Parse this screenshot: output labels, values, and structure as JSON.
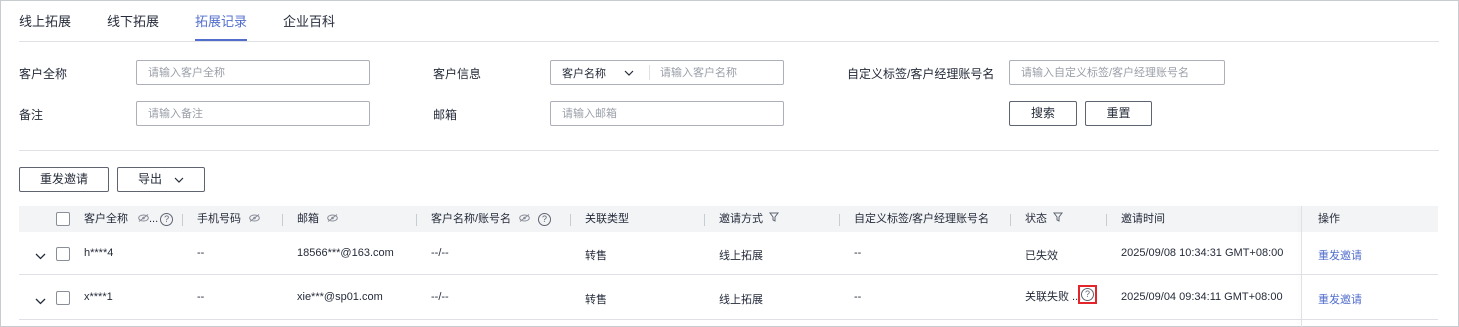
{
  "tabs": [
    "线上拓展",
    "线下拓展",
    "拓展记录",
    "企业百科"
  ],
  "active_tab": 2,
  "filters": {
    "customer_full_name": {
      "label": "客户全称",
      "placeholder": "请输入客户全称"
    },
    "customer_info": {
      "label": "客户信息",
      "select_value": "客户名称",
      "placeholder": "请输入客户名称"
    },
    "custom_tag": {
      "label": "自定义标签/客户经理账号名",
      "placeholder": "请输入自定义标签/客户经理账号名"
    },
    "remark": {
      "label": "备注",
      "placeholder": "请输入备注"
    },
    "email": {
      "label": "邮箱",
      "placeholder": "请输入邮箱"
    },
    "search_label": "搜索",
    "reset_label": "重置"
  },
  "toolbar": {
    "resend_label": "重发邀请",
    "export_label": "导出"
  },
  "columns": {
    "customer_full_name": "客户全称",
    "customer_full_name_ellipsis": "...",
    "phone": "手机号码",
    "email": "邮箱",
    "customer_account": "客户名称/账号名",
    "relation_type": "关联类型",
    "invite_method": "邀请方式",
    "custom_tag": "自定义标签/客户经理账号名",
    "status": "状态",
    "invite_time": "邀请时间",
    "action": "操作"
  },
  "rows": [
    {
      "name": "h****4",
      "phone": "--",
      "email": "18566***@163.com",
      "account": "--/--",
      "relation": "转售",
      "method": "线上拓展",
      "tag": "--",
      "status": "已失效",
      "time": "2025/09/08 10:34:31 GMT+08:00",
      "action": "重发邀请"
    },
    {
      "name": "x****1",
      "phone": "--",
      "email": "xie***@sp01.com",
      "account": "--/--",
      "relation": "转售",
      "method": "线上拓展",
      "tag": "--",
      "status": "关联失败 ...",
      "time": "2025/09/04 09:34:11 GMT+08:00",
      "action": "重发邀请"
    }
  ],
  "colors": {
    "accent": "#526ecc",
    "highlight": "#e3242b"
  }
}
